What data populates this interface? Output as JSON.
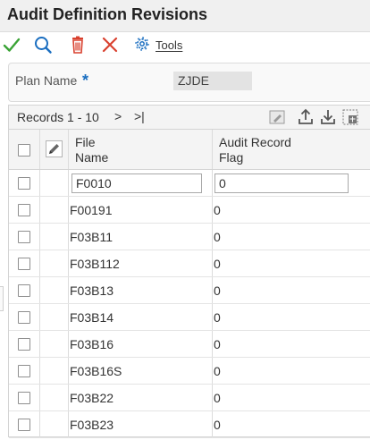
{
  "header": {
    "title": "Audit Definition Revisions"
  },
  "toolbar": {
    "icons": [
      "ok-check-icon",
      "search-icon",
      "delete-icon",
      "cancel-x-icon",
      "gear-icon"
    ],
    "tools_label": "Tools"
  },
  "form": {
    "plan_name_label": "Plan Name",
    "required_marker": "*",
    "plan_name_value": "ZJDE"
  },
  "grid": {
    "records_label": "Records 1 - 10",
    "next_label": ">",
    "last_label": ">|",
    "columns": {
      "file_name_line1": "File",
      "file_name_line2": "Name",
      "audit_flag_line1": "Audit Record",
      "audit_flag_line2": "Flag"
    },
    "filter": {
      "file_name": "F0010",
      "audit_flag": "0"
    },
    "rows": [
      {
        "file_name": "F00191",
        "audit_flag": "0"
      },
      {
        "file_name": "F03B11",
        "audit_flag": "0"
      },
      {
        "file_name": "F03B112",
        "audit_flag": "0"
      },
      {
        "file_name": "F03B13",
        "audit_flag": "0"
      },
      {
        "file_name": "F03B14",
        "audit_flag": "0"
      },
      {
        "file_name": "F03B16",
        "audit_flag": "0"
      },
      {
        "file_name": "F03B16S",
        "audit_flag": "0"
      },
      {
        "file_name": "F03B22",
        "audit_flag": "0"
      },
      {
        "file_name": "F03B23",
        "audit_flag": "0"
      }
    ]
  },
  "colors": {
    "accent_blue": "#1a6ec0",
    "ok_green": "#3aa335",
    "delete_red": "#d9412f"
  }
}
